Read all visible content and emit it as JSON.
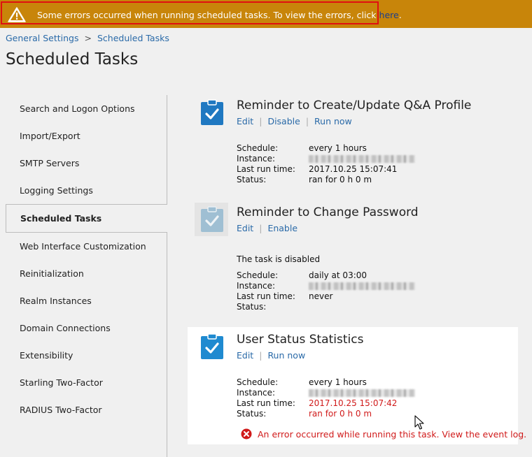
{
  "banner": {
    "message": "Some errors occurred when running scheduled tasks. To view the errors, click ",
    "link": "here",
    "suffix": ".",
    "color": "#c8850a"
  },
  "breadcrumb": {
    "items": [
      "General Settings",
      "Scheduled Tasks"
    ],
    "separator": ">"
  },
  "page_title": "Scheduled Tasks",
  "sidebar": {
    "items": [
      {
        "label": "Search and Logon Options"
      },
      {
        "label": "Import/Export"
      },
      {
        "label": "SMTP Servers"
      },
      {
        "label": "Logging Settings"
      },
      {
        "label": "Scheduled Tasks",
        "active": true
      },
      {
        "label": "Web Interface Customization"
      },
      {
        "label": "Reinitialization"
      },
      {
        "label": "Realm Instances"
      },
      {
        "label": "Domain Connections"
      },
      {
        "label": "Extensibility"
      },
      {
        "label": "Starling Two-Factor"
      },
      {
        "label": "RADIUS Two-Factor"
      }
    ]
  },
  "labels": {
    "schedule": "Schedule:",
    "instance": "Instance:",
    "last_run": "Last run time:",
    "status": "Status:"
  },
  "tasks": [
    {
      "title": "Reminder to Create/Update Q&A Profile",
      "actions": [
        "Edit",
        "Disable",
        "Run now"
      ],
      "schedule": "every 1 hours",
      "last_run": "2017.10.25 15:07:41",
      "status": "ran for 0 h 0 m",
      "icon": "clipboard-check-icon"
    },
    {
      "title": "Reminder to Change Password",
      "actions": [
        "Edit",
        "Enable"
      ],
      "note": "The task is disabled",
      "schedule": "daily at 03:00",
      "last_run": "never",
      "status": "",
      "icon": "clipboard-check-icon"
    },
    {
      "title": "User Status Statistics",
      "actions": [
        "Edit",
        "Run now"
      ],
      "schedule": "every 1 hours",
      "last_run": "2017.10.25 15:07:42",
      "status": "ran for 0 h 0 m",
      "error": {
        "message": "An error occurred while running this task.",
        "link": "View the event log."
      },
      "icon": "clipboard-check-icon"
    }
  ],
  "colors": {
    "link": "#2a6aa8",
    "error": "#d01a1a",
    "icon_active": "#1f78c1"
  }
}
